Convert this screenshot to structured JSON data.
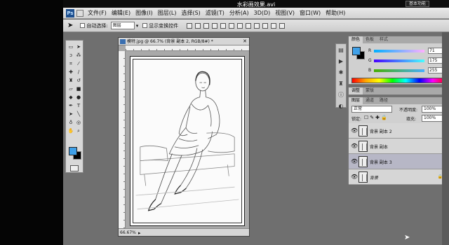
{
  "video_title": "水彩画效果.avi",
  "workspace_button": "基本功能",
  "app": {
    "logo": "Ps"
  },
  "menu": [
    "文件(F)",
    "编辑(E)",
    "图像(I)",
    "图层(L)",
    "选择(S)",
    "滤镜(T)",
    "分析(A)",
    "3D(D)",
    "视图(V)",
    "窗口(W)",
    "帮助(H)"
  ],
  "options": {
    "auto_select_label": "自动选择:",
    "auto_select_value": "图层",
    "show_transform_label": "显示变换控件"
  },
  "document": {
    "title": "模特.jpg @ 66.7% (背景 副本 2, RGB/8#) *",
    "zoom": "66.67%"
  },
  "color_panel": {
    "tabs": [
      "颜色",
      "色板",
      "样式"
    ],
    "r": "71",
    "g": "175",
    "b": "255",
    "fg_color": "#3fa0e8"
  },
  "adjust_tabs": [
    "调整",
    "蒙版"
  ],
  "layers_panel": {
    "tabs": [
      "图层",
      "通道",
      "路径"
    ],
    "blend_mode": "正常",
    "opacity_label": "不透明度:",
    "opacity": "100%",
    "lock_label": "锁定:",
    "fill_label": "填充:",
    "fill": "100%",
    "layers": [
      {
        "name": "背景 副本 2",
        "selected": false
      },
      {
        "name": "背景 副本",
        "selected": false
      },
      {
        "name": "背景 副本 3",
        "selected": true
      },
      {
        "name": "背景",
        "selected": false
      }
    ]
  }
}
